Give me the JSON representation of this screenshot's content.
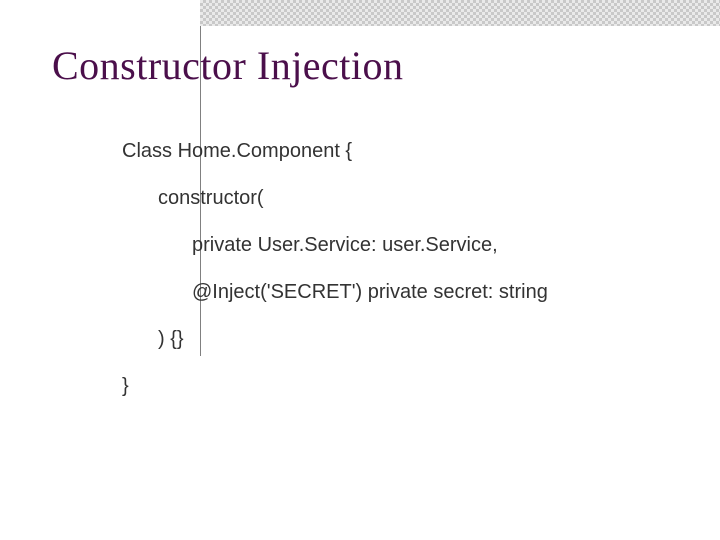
{
  "slide": {
    "title": "Constructor Injection",
    "code": {
      "l1": "Class Home.Component {",
      "l2": "constructor(",
      "l3": "private User.Service: user.Service,",
      "l4": "@Inject('SECRET') private secret: string",
      "l5": ") {}",
      "l6": "}"
    }
  }
}
